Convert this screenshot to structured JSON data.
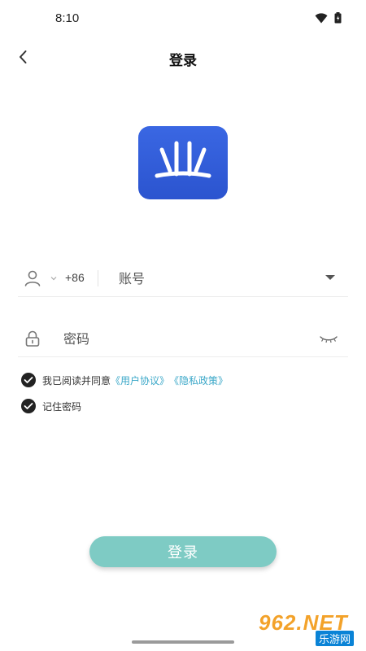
{
  "status_bar": {
    "time": "8:10",
    "icons": [
      "wifi-icon",
      "battery-icon"
    ]
  },
  "nav": {
    "title": "登录",
    "back_icon": "chevron-left-icon"
  },
  "logo": {
    "glyph": "业",
    "bg_color": "#2f5bd8"
  },
  "account": {
    "country_code": "+86",
    "placeholder": "账号",
    "user_icon": "user-icon",
    "dropdown_icon": "caret-down-icon"
  },
  "password": {
    "placeholder": "密码",
    "lock_icon": "lock-icon",
    "eye_icon": "eye-closed-icon"
  },
  "agreement": {
    "prefix": "我已阅读并同意",
    "user_agreement": "《用户协议》",
    "privacy_policy": "《隐私政策》",
    "checked": true
  },
  "remember": {
    "label": "记住密码",
    "checked": true
  },
  "login_button": {
    "label": "登录",
    "color": "#7ecbc4"
  },
  "watermark": {
    "brand": "962.NET",
    "sub": "乐游网"
  },
  "colors": {
    "accent_link": "#3aa7c8",
    "logo_blue": "#2f5bd8"
  }
}
